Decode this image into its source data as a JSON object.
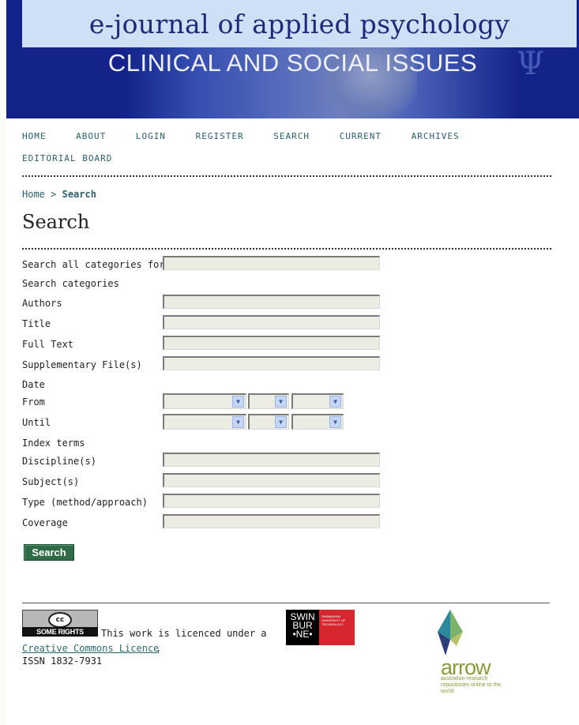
{
  "header": {
    "journal_name": "e-journal of applied psychology",
    "subtitle": "CLINICAL AND SOCIAL ISSUES",
    "psi_glyph": "Ψ"
  },
  "nav": {
    "items": [
      "HOME",
      "ABOUT",
      "LOGIN",
      "REGISTER",
      "SEARCH",
      "CURRENT",
      "ARCHIVES",
      "EDITORIAL BOARD"
    ]
  },
  "breadcrumb": {
    "home": "Home",
    "separator": " > ",
    "current": "Search"
  },
  "page_title": "Search",
  "form": {
    "search_all_label": "Search all categories for",
    "search_categories_heading": "Search categories",
    "authors_label": "Authors",
    "title_label": "Title",
    "full_text_label": "Full Text",
    "supp_file_label": "Supplementary File(s)",
    "date_heading": "Date",
    "from_label": "From",
    "until_label": "Until",
    "index_terms_heading": "Index terms",
    "discipline_label": "Discipline(s)",
    "subject_label": "Subject(s)",
    "type_label": "Type (method/approach)",
    "coverage_label": "Coverage",
    "search_all_value": "",
    "authors_value": "",
    "title_value": "",
    "full_text_value": "",
    "supp_file_value": "",
    "discipline_value": "",
    "subject_value": "",
    "type_value": "",
    "coverage_value": "",
    "submit_label": "Search"
  },
  "footer": {
    "cc_badge_symbol": "cc",
    "cc_badge_text": "SOME RIGHTS RESERVED",
    "licence_text": "This work is licenced under a",
    "licence_link": "Creative Commons Licence",
    "licence_period": ".",
    "issn": "ISSN 1832-7931",
    "swin_text": "SWIN BUR •NE•",
    "swin_sub": "SWINBURNE UNIVERSITY OF TECHNOLOGY",
    "arrow_word": "arrow",
    "arrow_tagline": "australian research repositories online to the world"
  },
  "colors": {
    "header_blue": "#13238a",
    "header_band": "#cfe0f6",
    "link_teal": "#2b5f6b",
    "button_green": "#2f6b46",
    "arrow_olive": "#8a9a3a",
    "swin_red": "#d8262e"
  }
}
